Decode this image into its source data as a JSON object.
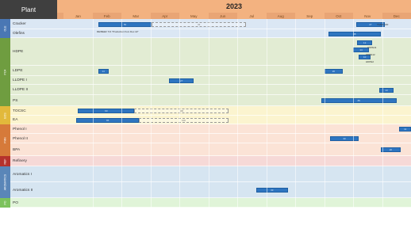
{
  "header": {
    "plant_label": "Plant",
    "year": "2023",
    "months": [
      "Jan",
      "Feb",
      "Mar",
      "Apr",
      "May",
      "Jun",
      "Jul",
      "Aug",
      "Sep",
      "Oct",
      "Nov",
      "Dec"
    ]
  },
  "groups": [
    {
      "label": "OLE",
      "color": "#4a77b4",
      "band": "#dbe7f4",
      "rows": [
        {
          "label": "Cracker",
          "bars": [
            {
              "start": 1.2,
              "end": 3.05,
              "text": "50"
            },
            {
              "start": 3.05,
              "end": 6.3,
              "text": "32",
              "style": "outline"
            },
            {
              "start": 10.1,
              "end": 11.1,
              "text": "27"
            }
          ]
        },
        {
          "label": "Olefins",
          "bars": [
            {
              "start": 9.15,
              "end": 10.95,
              "text": "38"
            }
          ]
        }
      ]
    },
    {
      "label": "PO4",
      "color": "#6f9d40",
      "band": "#e2ecd3",
      "rows": [
        {
          "label": "HDPE",
          "bars": [
            {
              "start": 10.15,
              "end": 10.65,
              "text": "12"
            },
            {
              "start": 10.0,
              "end": 10.55,
              "text": "14"
            },
            {
              "start": 10.2,
              "end": 10.6,
              "text": "10"
            }
          ]
        },
        {
          "label": "LDPE",
          "bars": [
            {
              "start": 1.2,
              "end": 1.55,
              "text": "14"
            },
            {
              "start": 9.0,
              "end": 9.65,
              "text": "20"
            }
          ]
        },
        {
          "label": "LLDPE I",
          "bars": [
            {
              "start": 3.65,
              "end": 4.5,
              "text": "27"
            }
          ]
        },
        {
          "label": "LLDPE II",
          "bars": [
            {
              "start": 10.9,
              "end": 11.4,
              "text": "13"
            }
          ]
        },
        {
          "label": "PS",
          "bars": [
            {
              "start": 8.9,
              "end": 11.5,
              "text": "85"
            }
          ]
        }
      ]
    },
    {
      "label": "EOS",
      "color": "#e2b93b",
      "band": "#fbf4cf",
      "rows": [
        {
          "label": "TOCSC",
          "bars": [
            {
              "start": 0.5,
              "end": 2.45,
              "text": "60"
            },
            {
              "start": 2.45,
              "end": 5.7,
              "text": "100",
              "style": "outline"
            }
          ]
        },
        {
          "label": "EA",
          "bars": [
            {
              "start": 0.45,
              "end": 2.6,
              "text": "65"
            },
            {
              "start": 2.6,
              "end": 5.7,
              "text": "100",
              "style": "outline"
            }
          ]
        }
      ]
    },
    {
      "label": "PHN",
      "color": "#d67a3a",
      "band": "#fbe3d6",
      "rows": [
        {
          "label": "Phenol I",
          "bars": [
            {
              "start": 11.6,
              "end": 12.0,
              "text": "11"
            }
          ]
        },
        {
          "label": "Phenol II",
          "bars": [
            {
              "start": 9.2,
              "end": 10.2,
              "text": "30"
            }
          ]
        },
        {
          "label": "BPA",
          "bars": [
            {
              "start": 10.95,
              "end": 11.65,
              "text": "20"
            }
          ]
        }
      ]
    },
    {
      "label": "REF",
      "color": "#b5322c",
      "band": "#f6d9d7",
      "rows": [
        {
          "label": "Refinery",
          "bars": []
        }
      ]
    },
    {
      "label": "AROMATICS",
      "color": "#5a86b8",
      "band": "#d6e5f1",
      "rows": [
        {
          "label": "Aromatics I",
          "bars": []
        },
        {
          "label": "Aromatics II",
          "bars": [
            {
              "start": 6.65,
              "end": 7.75,
              "text": "33"
            }
          ]
        }
      ]
    },
    {
      "label": "PO",
      "color": "#7cc25c",
      "band": "#e0f4d8",
      "rows": [
        {
          "label": "PO",
          "bars": []
        }
      ]
    }
  ],
  "notes": {
    "cracker_side": "TA/ES 100",
    "cracker_sub": "RE/BEEF T/A \"Production from Dec 22\"",
    "hdpe_1": "HDPE11",
    "hdpe_2": "HDPE12",
    "hdpe_3": "HDPE2"
  }
}
